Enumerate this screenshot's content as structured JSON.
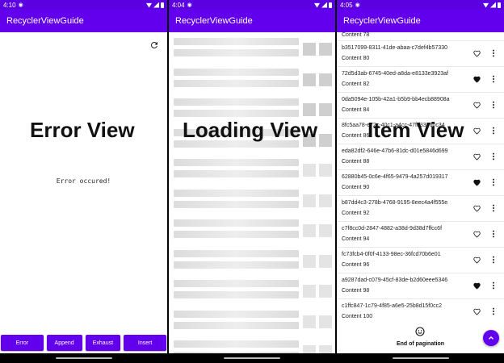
{
  "app_title": "RecyclerViewGuide",
  "colors": {
    "primary": "#6200ee",
    "status_bar": "#5b00e0"
  },
  "screens": [
    {
      "time": "4:10",
      "overlay_title": "Error View",
      "error_message": "Error occured!",
      "buttons": [
        "Error",
        "Append",
        "Exhaust",
        "Insert"
      ],
      "icons": [
        "refresh-icon"
      ]
    },
    {
      "time": "4:04",
      "overlay_title": "Loading View"
    },
    {
      "time": "4:05",
      "overlay_title": "Item View",
      "top_partial_content": "Content 78",
      "items": [
        {
          "uuid": "b3517099-8311-41de-abaa-c7def4b57330",
          "content": "Content 80",
          "favorite": false
        },
        {
          "uuid": "72d5d3ab-6745-40ed-a8da-e8133e3923af",
          "content": "Content 82",
          "favorite": true
        },
        {
          "uuid": "0da5094e-105b-42a1-b5b9-bb4ecb88908a",
          "content": "Content 84",
          "favorite": false
        },
        {
          "uuid": "8fc5aa78-e72c-40c1-a4cc-47fd33760c34",
          "content": "Content 86",
          "favorite": false
        },
        {
          "uuid": "eda82df2-646e-47b6-81dc-d01e5846d699",
          "content": "Content 88",
          "favorite": false
        },
        {
          "uuid": "62880b45-0c6e-4f65-9479-4a257d019317",
          "content": "Content 90",
          "favorite": true
        },
        {
          "uuid": "b87dd4c3-278b-4768-9195-8eec4a4f555e",
          "content": "Content 92",
          "favorite": false
        },
        {
          "uuid": "c7f8cc0d-2847-4882-a38d-9d38d7ffcc6f",
          "content": "Content 94",
          "favorite": false
        },
        {
          "uuid": "fc73fcb4-0f0f-4133-98ec-36fcd70b6e01",
          "content": "Content 96",
          "favorite": false
        },
        {
          "uuid": "a9287dad-c079-45cf-83de-b2d60eee5346",
          "content": "Content 98",
          "favorite": true
        },
        {
          "uuid": "c1ffc847-1c79-4f85-a6e5-25b8d15f0cc2",
          "content": "Content 100",
          "favorite": false
        }
      ],
      "footer_text": "End of pagination",
      "icons": [
        "smile-icon",
        "arrow-up-icon",
        "heart-icon",
        "more-vert-icon"
      ]
    }
  ]
}
